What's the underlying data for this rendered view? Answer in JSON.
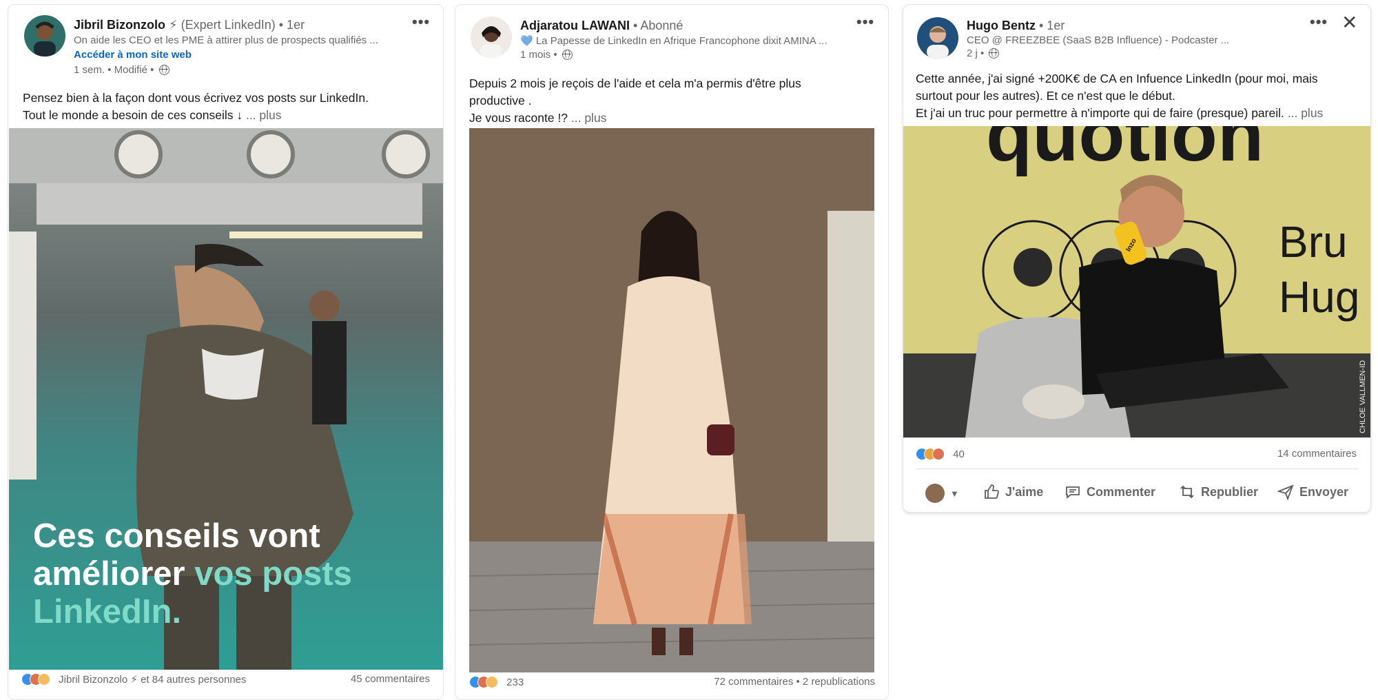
{
  "colors": {
    "link_blue": "#0a66c2",
    "accent_teal": "#7fdac8",
    "muted_text": "#666666"
  },
  "posts": [
    {
      "author": "Jibril Bizonzolo",
      "author_suffix": "⚡ (Expert LinkedIn)",
      "degree": "• 1er",
      "headline": "On aide les CEO et les PME à attirer plus de prospects qualifiés ...",
      "website_link": "Accéder à mon site web",
      "time": "1 sem. • Modifié •",
      "visibility_icon": "globe-icon",
      "text_lines": [
        "Pensez bien à la façon dont vous écrivez vos posts sur LinkedIn.",
        "Tout le monde a besoin de ces conseils ↓"
      ],
      "more": "... plus",
      "image_caption": {
        "line1": "Ces conseils vont",
        "line2_plain": "améliorer",
        "line2_accent": "vos posts",
        "line3_accent": "LinkedIn."
      },
      "reactions_text": "Jibril Bizonzolo ⚡ et 84 autres personnes",
      "comments": "45 commentaires"
    },
    {
      "author": "Adjaratou LAWANI",
      "degree": "• Abonné",
      "headline": "💙 La Papesse de LinkedIn en Afrique Francophone dixit AMINA ...",
      "time": "1 mois •",
      "visibility_icon": "globe-icon",
      "text_lines": [
        "Depuis 2 mois je reçois de l'aide et cela m'a permis d'être plus",
        "productive .",
        "Je vous raconte !?"
      ],
      "more": "... plus",
      "reactions_count": "233",
      "comments": "72 commentaires • 2 republications"
    },
    {
      "author": "Hugo Bentz",
      "degree": "• 1er",
      "headline": "CEO @ FREEZBEE (SaaS B2B Influence) - Podcaster ...",
      "time": "2 j •",
      "visibility_icon": "globe-icon",
      "text_lines": [
        "Cette année, j'ai signé +200K€ de CA en Infuence LinkedIn (pour moi, mais",
        "surtout pour les autres). Et ce n'est que le début.",
        "Et j'ai un truc pour permettre à n'importe qui de faire (presque) pareil."
      ],
      "more": "... plus",
      "image_text": {
        "backdrop_word": "quotion",
        "name_bru": "Bru",
        "name_hug": "Hug",
        "mic_brand": "Inzo",
        "watermark": "CHLOE VALLMEN-ID"
      },
      "reactions_count": "40",
      "comments": "14 commentaires",
      "actions": {
        "like": "J'aime",
        "comment": "Commenter",
        "repost": "Republier",
        "send": "Envoyer"
      }
    }
  ]
}
